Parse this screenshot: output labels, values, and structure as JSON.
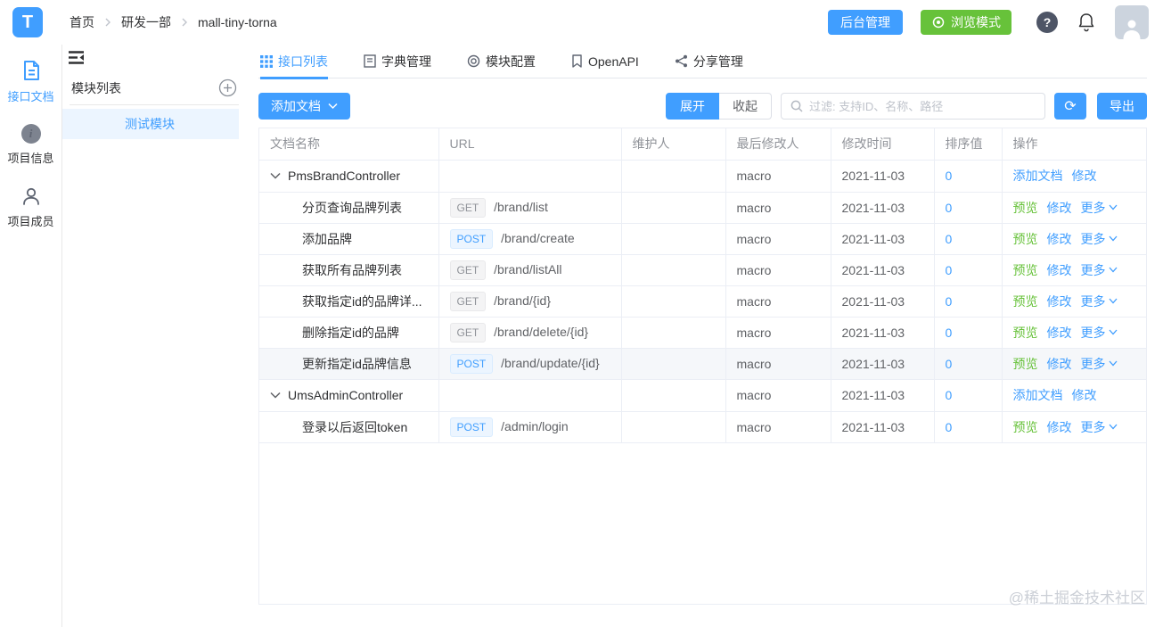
{
  "colors": {
    "primary": "#409eff",
    "success": "#67c23a",
    "get_tag_text": "#909399",
    "get_tag_bg": "#f4f4f5",
    "post_tag_text": "#409eff",
    "post_tag_bg": "#ecf5ff",
    "module_active_bg": "#ecf5ff"
  },
  "icons": {
    "refresh": "⟳",
    "help": "?"
  },
  "header": {
    "logo_letter": "T",
    "breadcrumb": [
      "首页",
      "研发一部",
      "mall-tiny-torna"
    ],
    "admin_button": "后台管理",
    "browse_button": "浏览模式"
  },
  "left_nav": {
    "items": [
      {
        "label": "接口文档",
        "icon": "api-doc-icon",
        "active": true
      },
      {
        "label": "项目信息",
        "icon": "project-info-icon",
        "active": false
      },
      {
        "label": "项目成员",
        "icon": "project-members-icon",
        "active": false
      }
    ]
  },
  "module_panel": {
    "title": "模块列表",
    "modules": [
      {
        "label": "测试模块",
        "active": true
      }
    ]
  },
  "tabs": [
    {
      "label": "接口列表",
      "icon": "grid-icon",
      "active": true
    },
    {
      "label": "字典管理",
      "icon": "dict-icon",
      "active": false
    },
    {
      "label": "模块配置",
      "icon": "config-icon",
      "active": false
    },
    {
      "label": "OpenAPI",
      "icon": "bookmark-icon",
      "active": false
    },
    {
      "label": "分享管理",
      "icon": "share-icon",
      "active": false
    }
  ],
  "toolbar": {
    "add_doc": "添加文档",
    "expand": "展开",
    "collapse": "收起",
    "search_placeholder": "过滤: 支持ID、名称、路径",
    "export": "导出"
  },
  "table": {
    "headers": [
      "文档名称",
      "URL",
      "维护人",
      "最后修改人",
      "修改时间",
      "排序值",
      "操作"
    ],
    "group_ops": [
      "添加文档",
      "修改"
    ],
    "doc_ops": [
      "预览",
      "修改",
      "更多"
    ],
    "rows": [
      {
        "type": "group",
        "name": "PmsBrandController",
        "method": "",
        "url": "",
        "maintainer": "",
        "modifier": "macro",
        "date": "2021-11-03",
        "order": "0"
      },
      {
        "type": "doc",
        "name": "分页查询品牌列表",
        "method": "GET",
        "url": "/brand/list",
        "maintainer": "",
        "modifier": "macro",
        "date": "2021-11-03",
        "order": "0"
      },
      {
        "type": "doc",
        "name": "添加品牌",
        "method": "POST",
        "url": "/brand/create",
        "maintainer": "",
        "modifier": "macro",
        "date": "2021-11-03",
        "order": "0"
      },
      {
        "type": "doc",
        "name": "获取所有品牌列表",
        "method": "GET",
        "url": "/brand/listAll",
        "maintainer": "",
        "modifier": "macro",
        "date": "2021-11-03",
        "order": "0"
      },
      {
        "type": "doc",
        "name": "获取指定id的品牌详...",
        "method": "GET",
        "url": "/brand/{id}",
        "maintainer": "",
        "modifier": "macro",
        "date": "2021-11-03",
        "order": "0"
      },
      {
        "type": "doc",
        "name": "删除指定id的品牌",
        "method": "GET",
        "url": "/brand/delete/{id}",
        "maintainer": "",
        "modifier": "macro",
        "date": "2021-11-03",
        "order": "0"
      },
      {
        "type": "doc",
        "name": "更新指定id品牌信息",
        "method": "POST",
        "url": "/brand/update/{id}",
        "maintainer": "",
        "modifier": "macro",
        "date": "2021-11-03",
        "order": "0",
        "highlighted": true
      },
      {
        "type": "group",
        "name": "UmsAdminController",
        "method": "",
        "url": "",
        "maintainer": "",
        "modifier": "macro",
        "date": "2021-11-03",
        "order": "0"
      },
      {
        "type": "doc",
        "name": "登录以后返回token",
        "method": "POST",
        "url": "/admin/login",
        "maintainer": "",
        "modifier": "macro",
        "date": "2021-11-03",
        "order": "0"
      }
    ]
  },
  "watermark": "@稀土掘金技术社区"
}
